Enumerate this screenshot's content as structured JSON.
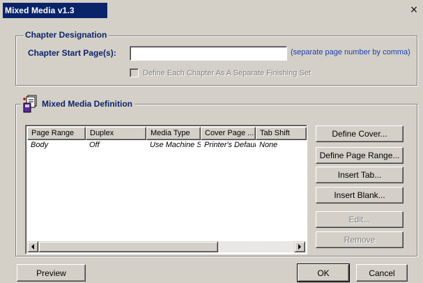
{
  "window": {
    "title": "Mixed Media v1.3",
    "close_glyph": "×"
  },
  "chapter": {
    "group_label": "Chapter Designation",
    "start_label": "Chapter Start Page(s):",
    "start_value": "",
    "hint": "(separate page number by comma)",
    "checkbox_label": "Define Each Chapter As A Separate Finishing Set",
    "checkbox_checked": false,
    "checkbox_enabled": false
  },
  "media": {
    "group_label": "Mixed Media Definition",
    "group_icon": "mixed-media-icon",
    "columns": [
      "Page Range",
      "Duplex",
      "Media Type",
      "Cover Page ...",
      "Tab Shift"
    ],
    "rows": [
      [
        "Body",
        "Off",
        "Use Machine Se",
        "Printer's Default",
        "None"
      ]
    ],
    "buttons": {
      "define_cover": "Define Cover...",
      "define_page_range": "Define Page Range...",
      "insert_tab": "Insert Tab...",
      "insert_blank": "Insert Blank...",
      "edit": "Edit...",
      "remove": "Remove"
    }
  },
  "footer": {
    "preview": "Preview",
    "ok": "OK",
    "cancel": "Cancel"
  },
  "colors": {
    "title_bar": "#0a246a",
    "label_blue": "#0a246a",
    "hint_blue": "#1a3fae",
    "face": "#d4d0c8"
  }
}
